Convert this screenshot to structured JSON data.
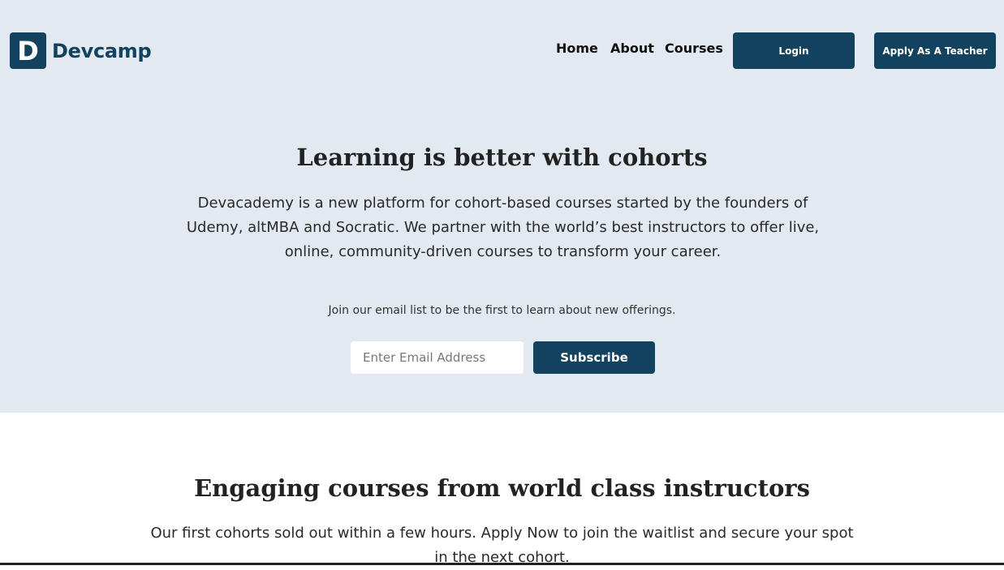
{
  "brand": {
    "logo_letter": "D",
    "name": "Devcamp",
    "color": "#13425f"
  },
  "nav": {
    "links": [
      "Home",
      "About",
      "Courses"
    ],
    "login_label": "Login",
    "apply_label": "Apply As A Teacher"
  },
  "hero": {
    "title": "Learning is better with cohorts",
    "description": "Devacademy is a new platform for cohort-based courses started by the founders of Udemy, altMBA and Socratic. We partner with the world’s best instructors to offer live, online, community-driven courses to transform your career.",
    "signup_note": "Join our email list to be the first to learn about new offerings.",
    "email_placeholder": "Enter Email Address",
    "subscribe_label": "Subscribe",
    "background": "#e2e9f0"
  },
  "courses_section": {
    "title": "Engaging courses from world class instructors",
    "description": "Our first cohorts sold out within a few hours. Apply Now to join the waitlist and secure your spot in the next cohort."
  }
}
